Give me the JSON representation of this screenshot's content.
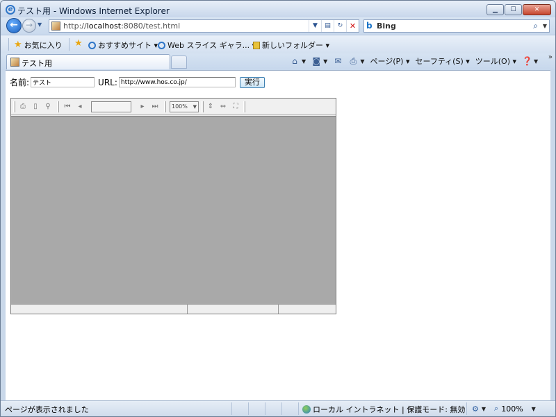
{
  "window": {
    "title": "テスト用 - Windows Internet Explorer"
  },
  "address": {
    "url_prefix": "http://",
    "url_host": "localhost",
    "url_rest": ":8080/test.html"
  },
  "search": {
    "provider": "Bing"
  },
  "favorites": {
    "favorites_label": "お気に入り",
    "items": [
      {
        "label": "おすすめサイト ▾"
      },
      {
        "label": "Web スライス ギャラ... ▾"
      },
      {
        "label": "新しいフォルダー ▾"
      }
    ]
  },
  "tabs": {
    "active_label": "テスト用"
  },
  "commands": {
    "page": "ページ(P) ▾",
    "safety": "セーフティ(S) ▾",
    "tools": "ツール(O) ▾",
    "more": "»"
  },
  "form": {
    "name_label": "名前:",
    "name_value": "テスト",
    "url_label": "URL:",
    "url_value": "http://www.hos.co.jp/",
    "exec_label": "実行"
  },
  "viewer": {
    "zoom_value": "100%",
    "page_value": ""
  },
  "statusbar": {
    "message": "ページが表示されました",
    "zone": "ローカル イントラネット | 保護モード: 無効",
    "zoom": "100%"
  },
  "colors": {
    "accent": "#2f76c8",
    "viewer_canvas": "#a9a9a9",
    "exec_border": "#3c7fb1"
  }
}
